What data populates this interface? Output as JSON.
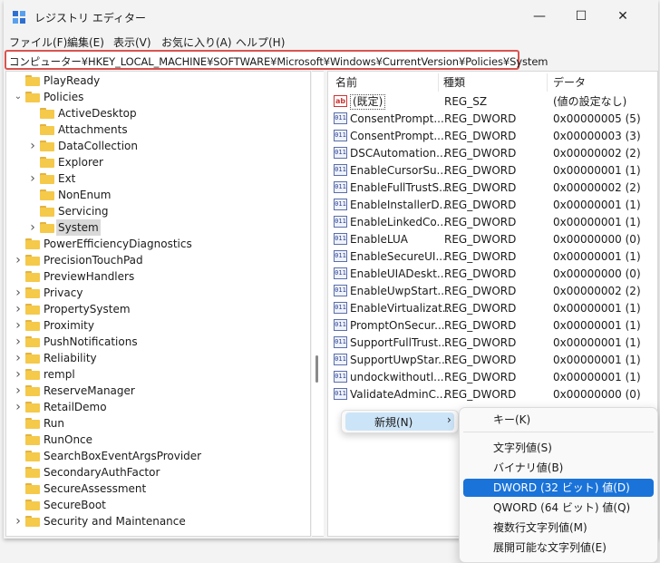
{
  "window": {
    "title": "レジストリ エディター",
    "controls": {
      "minimize": "—",
      "maximize": "☐",
      "close": "✕"
    }
  },
  "menu": [
    "ファイル(F)",
    "編集(E)",
    "表示(V)",
    "お気に入り(A)",
    "ヘルプ(H)"
  ],
  "address": "コンピューター¥HKEY_LOCAL_MACHINE¥SOFTWARE¥Microsoft¥Windows¥CurrentVersion¥Policies¥System",
  "tree": [
    {
      "label": "PlayReady",
      "chevron": ""
    },
    {
      "label": "Policies",
      "chevron": "v"
    },
    {
      "label": "ActiveDesktop",
      "chevron": ""
    },
    {
      "label": "Attachments",
      "chevron": ""
    },
    {
      "label": "DataCollection",
      "chevron": ">"
    },
    {
      "label": "Explorer",
      "chevron": ""
    },
    {
      "label": "Ext",
      "chevron": ">"
    },
    {
      "label": "NonEnum",
      "chevron": ""
    },
    {
      "label": "Servicing",
      "chevron": ""
    },
    {
      "label": "System",
      "chevron": ">",
      "selected": true
    },
    {
      "label": "PowerEfficiencyDiagnostics",
      "chevron": ""
    },
    {
      "label": "PrecisionTouchPad",
      "chevron": ">"
    },
    {
      "label": "PreviewHandlers",
      "chevron": ""
    },
    {
      "label": "Privacy",
      "chevron": ">"
    },
    {
      "label": "PropertySystem",
      "chevron": ">"
    },
    {
      "label": "Proximity",
      "chevron": ">"
    },
    {
      "label": "PushNotifications",
      "chevron": ">"
    },
    {
      "label": "Reliability",
      "chevron": ">"
    },
    {
      "label": "rempl",
      "chevron": ">"
    },
    {
      "label": "ReserveManager",
      "chevron": ">"
    },
    {
      "label": "RetailDemo",
      "chevron": ">"
    },
    {
      "label": "Run",
      "chevron": ""
    },
    {
      "label": "RunOnce",
      "chevron": ""
    },
    {
      "label": "SearchBoxEventArgsProvider",
      "chevron": ""
    },
    {
      "label": "SecondaryAuthFactor",
      "chevron": ""
    },
    {
      "label": "SecureAssessment",
      "chevron": ""
    },
    {
      "label": "SecureBoot",
      "chevron": ""
    },
    {
      "label": "Security and Maintenance",
      "chevron": ">"
    }
  ],
  "columns": {
    "name": "名前",
    "type": "種類",
    "data": "データ"
  },
  "values": [
    {
      "name": "(既定)",
      "type": "REG_SZ",
      "data": "(値の設定なし)",
      "icon": "ab"
    },
    {
      "name": "ConsentPrompt...",
      "type": "REG_DWORD",
      "data": "0x00000005 (5)",
      "icon": "dword"
    },
    {
      "name": "ConsentPrompt...",
      "type": "REG_DWORD",
      "data": "0x00000003 (3)",
      "icon": "dword"
    },
    {
      "name": "DSCAutomation...",
      "type": "REG_DWORD",
      "data": "0x00000002 (2)",
      "icon": "dword"
    },
    {
      "name": "EnableCursorSu...",
      "type": "REG_DWORD",
      "data": "0x00000001 (1)",
      "icon": "dword"
    },
    {
      "name": "EnableFullTrustS...",
      "type": "REG_DWORD",
      "data": "0x00000002 (2)",
      "icon": "dword"
    },
    {
      "name": "EnableInstallerD...",
      "type": "REG_DWORD",
      "data": "0x00000001 (1)",
      "icon": "dword"
    },
    {
      "name": "EnableLinkedCo...",
      "type": "REG_DWORD",
      "data": "0x00000001 (1)",
      "icon": "dword"
    },
    {
      "name": "EnableLUA",
      "type": "REG_DWORD",
      "data": "0x00000000 (0)",
      "icon": "dword"
    },
    {
      "name": "EnableSecureUI...",
      "type": "REG_DWORD",
      "data": "0x00000001 (1)",
      "icon": "dword"
    },
    {
      "name": "EnableUIADeskt...",
      "type": "REG_DWORD",
      "data": "0x00000000 (0)",
      "icon": "dword"
    },
    {
      "name": "EnableUwpStart...",
      "type": "REG_DWORD",
      "data": "0x00000002 (2)",
      "icon": "dword"
    },
    {
      "name": "EnableVirtualizat...",
      "type": "REG_DWORD",
      "data": "0x00000001 (1)",
      "icon": "dword"
    },
    {
      "name": "PromptOnSecur...",
      "type": "REG_DWORD",
      "data": "0x00000001 (1)",
      "icon": "dword"
    },
    {
      "name": "SupportFullTrust...",
      "type": "REG_DWORD",
      "data": "0x00000001 (1)",
      "icon": "dword"
    },
    {
      "name": "SupportUwpStar...",
      "type": "REG_DWORD",
      "data": "0x00000001 (1)",
      "icon": "dword"
    },
    {
      "name": "undockwithoutl...",
      "type": "REG_DWORD",
      "data": "0x00000001 (1)",
      "icon": "dword"
    },
    {
      "name": "ValidateAdminC...",
      "type": "REG_DWORD",
      "data": "0x00000000 (0)",
      "icon": "dword"
    }
  ],
  "context_menu": {
    "new_label": "新規(N)",
    "new_arrow": "›",
    "submenu": [
      {
        "label": "キー(K)",
        "separator_after": true
      },
      {
        "label": "文字列値(S)"
      },
      {
        "label": "バイナリ値(B)"
      },
      {
        "label": "DWORD (32 ビット) 値(D)",
        "highlighted": true
      },
      {
        "label": "QWORD (64 ビット) 値(Q)"
      },
      {
        "label": "複数行文字列値(M)"
      },
      {
        "label": "展開可能な文字列値(E)"
      }
    ]
  },
  "colors": {
    "accent": "#1a73d9",
    "address_border": "#d9534f",
    "folder": "#f5c94a"
  }
}
